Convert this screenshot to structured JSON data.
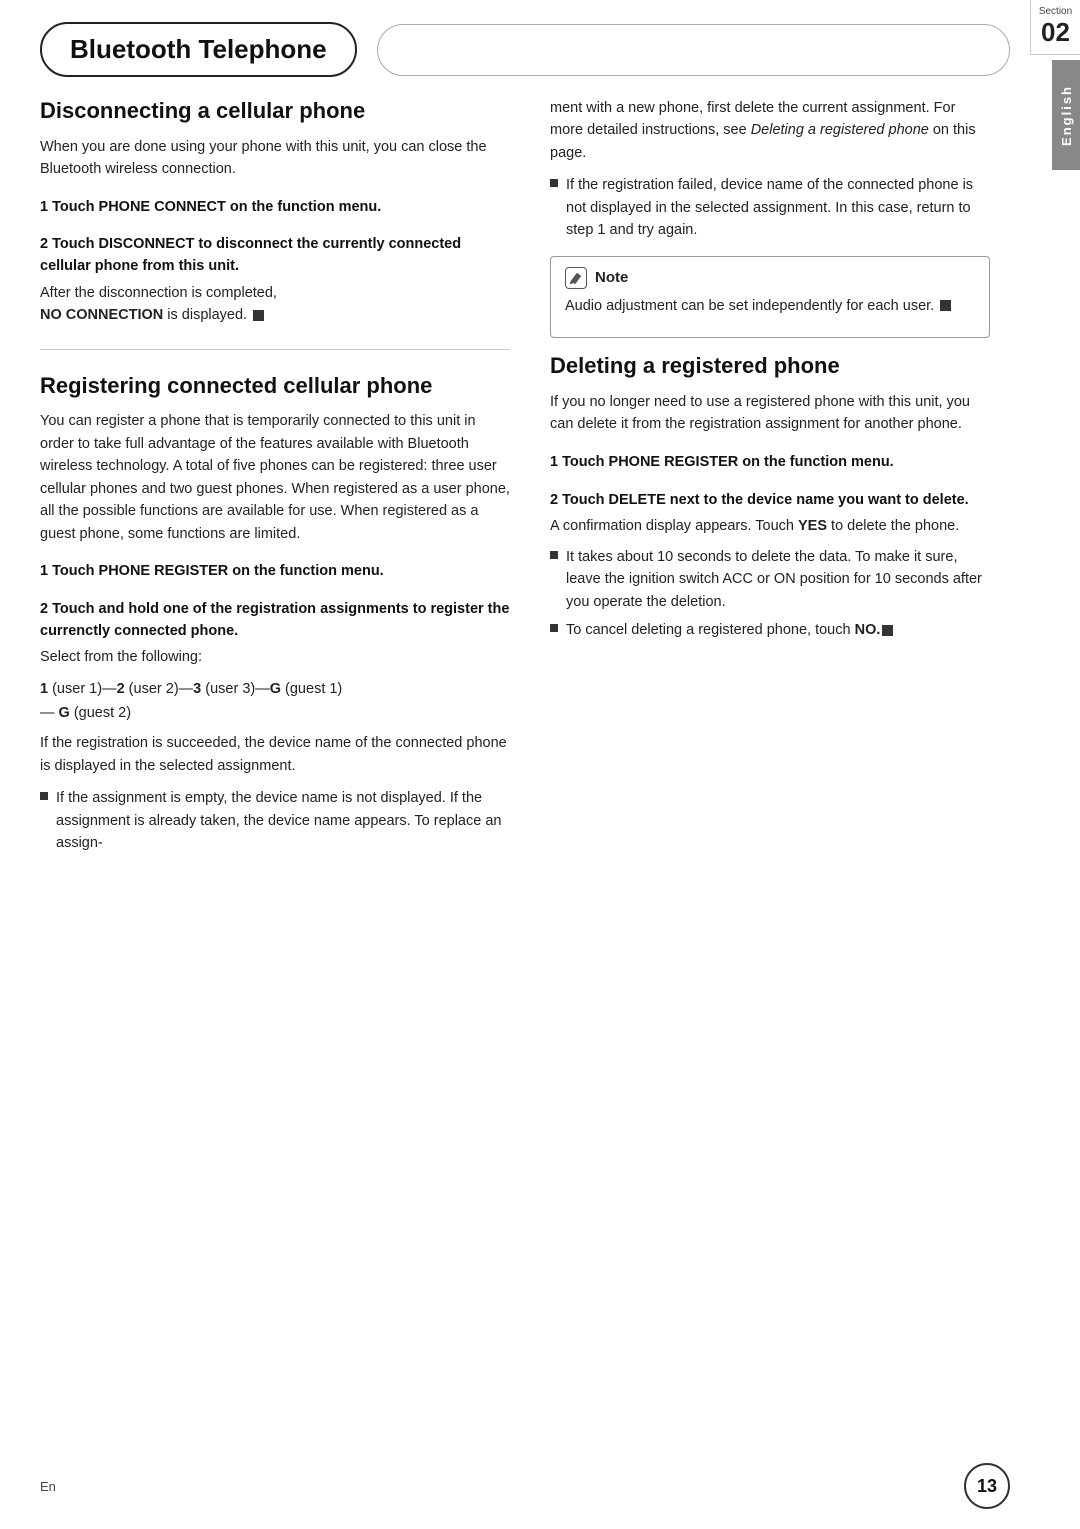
{
  "header": {
    "title": "Bluetooth Telephone",
    "right_pill": "",
    "section_label": "Section",
    "section_number": "02"
  },
  "sidebar": {
    "language": "English"
  },
  "left_column": {
    "section1": {
      "title": "Disconnecting a cellular phone",
      "intro": "When you are done using your phone with this unit, you can close the Bluetooth wireless connection.",
      "step1_heading": "1   Touch PHONE CONNECT on the function menu.",
      "step2_heading": "2   Touch DISCONNECT to disconnect the currently connected cellular phone from this unit.",
      "step2_body": "After the disconnection is completed,",
      "step2_bold": "NO CONNECTION",
      "step2_end": " is displayed."
    },
    "section2": {
      "title": "Registering connected cellular phone",
      "intro": "You can register a phone that is temporarily connected to this unit in order to take full advantage of the features available with Bluetooth wireless technology. A total of five phones can be registered: three user cellular phones and two guest phones. When registered as a user phone, all the possible functions are available for use. When registered as a guest phone, some functions are limited.",
      "step1_heading": "1   Touch PHONE REGISTER on the function menu.",
      "step2_heading": "2   Touch and hold one of the registration assignments to register the currenctly connected phone.",
      "step2_body": "Select from the following:",
      "sequence": "1 (user 1)—2 (user 2)—3 (user 3)—G (guest 1) — G (guest 2)",
      "sequence_detail": "If the registration is succeeded, the device name of the connected phone is displayed in the selected assignment.",
      "bullet1": "If the assignment is empty, the device name is not displayed. If the assignment is already taken, the device name appears. To replace an assign-"
    }
  },
  "right_column": {
    "cont_text": "ment with a new phone, first delete the current assignment. For more detailed instructions, see ",
    "cont_italic": "Deleting a registered phone",
    "cont_end": " on this page.",
    "bullet2": "If the registration failed, device name of the connected phone is not displayed in the selected assignment. In this case, return to step 1 and try again.",
    "note": {
      "header": "Note",
      "body": "Audio adjustment can be set independently for each user."
    },
    "section3": {
      "title": "Deleting a registered phone",
      "intro": "If you no longer need to use a registered phone with this unit, you can delete it from the registration assignment for another phone.",
      "step1_heading": "1   Touch PHONE REGISTER on the function menu.",
      "step2_heading": "2   Touch DELETE next to the device name you want to delete.",
      "step2_body": "A confirmation display appears. Touch ",
      "step2_bold": "YES",
      "step2_end": " to delete the phone.",
      "bullet3": "It takes about 10 seconds to delete the data. To make it sure, leave the ignition switch ACC or ON position for 10 seconds after you operate the deletion.",
      "bullet4": "To cancel deleting a registered phone, touch ",
      "bullet4_bold": "NO."
    }
  },
  "footer": {
    "lang": "En",
    "page": "13"
  }
}
